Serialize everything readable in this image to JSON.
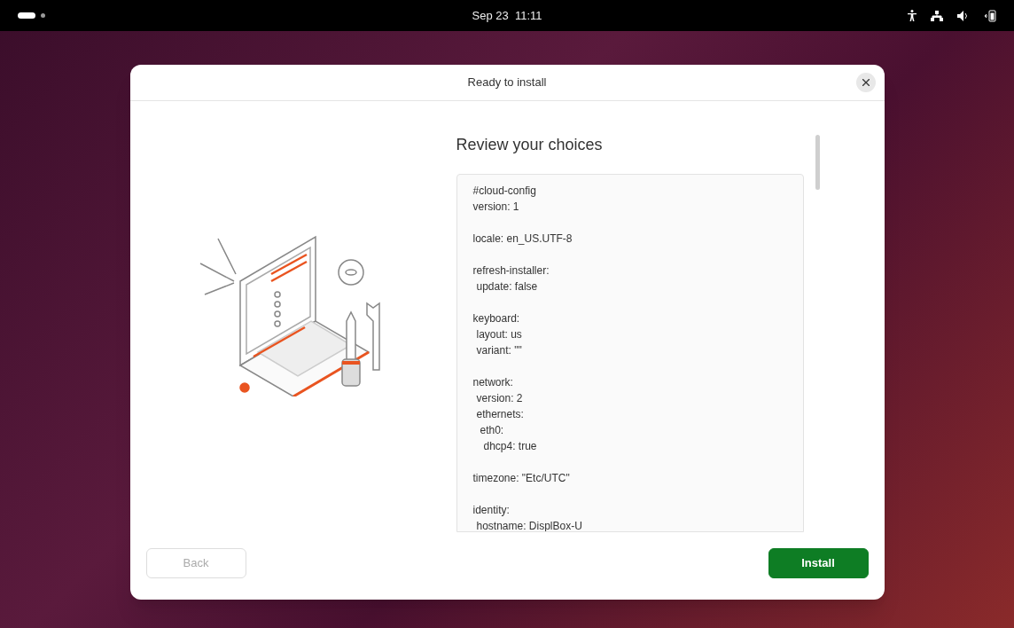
{
  "top_bar": {
    "clock": "Sep 23  11:11"
  },
  "dialog": {
    "title": "Ready to install",
    "heading": "Review your choices",
    "config": [
      [
        {
          "text": "#cloud-config"
        },
        {
          "text": "version: 1"
        }
      ],
      [
        {
          "text": "locale: en_US.UTF-8"
        }
      ],
      [
        {
          "text": "refresh-installer:",
          "children": [
            {
              "text": "update: false"
            }
          ]
        }
      ],
      [
        {
          "text": "keyboard:",
          "children": [
            {
              "text": "layout: us"
            },
            {
              "text": "variant: \"\""
            }
          ]
        }
      ],
      [
        {
          "text": "network:",
          "children": [
            {
              "text": "version: 2"
            },
            {
              "text": "ethernets:",
              "children": [
                {
                  "text": "eth0:",
                  "children": [
                    {
                      "text": "dhcp4: true"
                    }
                  ]
                }
              ]
            }
          ]
        }
      ],
      [
        {
          "text": "timezone: \"Etc/UTC\""
        }
      ],
      [
        {
          "text": "identity:",
          "children": [
            {
              "text": "hostname: DisplBox-U"
            }
          ]
        }
      ]
    ],
    "buttons": [
      {
        "label": "Back",
        "kind": "secondary",
        "disabled": true
      },
      {
        "label": "Install",
        "kind": "primary",
        "disabled": false
      }
    ]
  }
}
